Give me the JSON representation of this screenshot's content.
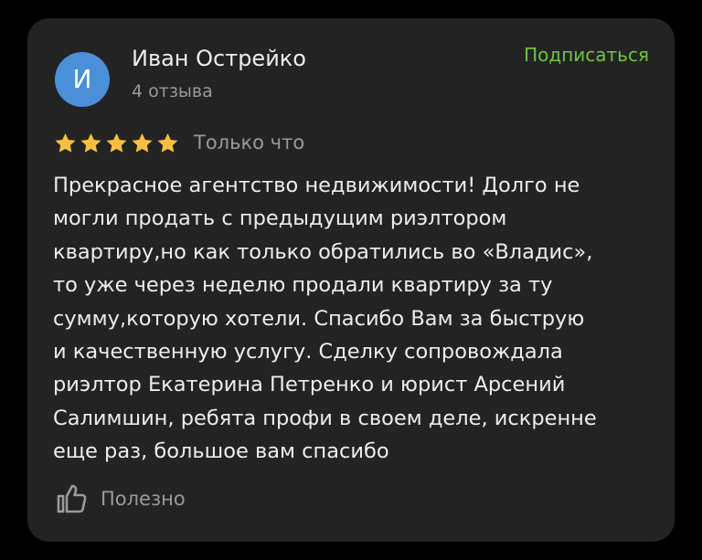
{
  "review": {
    "author": {
      "avatar_letter": "И",
      "avatar_color": "#4a8fd8",
      "name": "Иван Острейко",
      "review_count": "4 отзыва"
    },
    "subscribe_label": "Подписаться",
    "rating": 5,
    "rating_max": 5,
    "star_color": "#f5bf42",
    "date": "Только что",
    "text_lines": [
      "Прекрасное агентство недвижимости! Долго не",
      "могли продать с предыдущим риэлтором",
      "квартиру,но как только обратились во «Владис»,",
      "то уже через неделю продали квартиру за ту",
      "сумму,которую хотели. Спасибо Вам за быструю",
      "и качественную услугу. Сделку сопровождала",
      "риэлтор Екатерина Петренко и юрист Арсений",
      "Салимшин, ребята профи в своем деле, искренне",
      "еще раз, большое вам спасибо"
    ],
    "useful_label": "Полезно",
    "useful_icon": "thumbs-up-icon"
  },
  "theme": {
    "background": "#000000",
    "card": "#232323",
    "accent": "#6fc43f",
    "text": "#ededed",
    "muted": "#9a9a9a"
  }
}
